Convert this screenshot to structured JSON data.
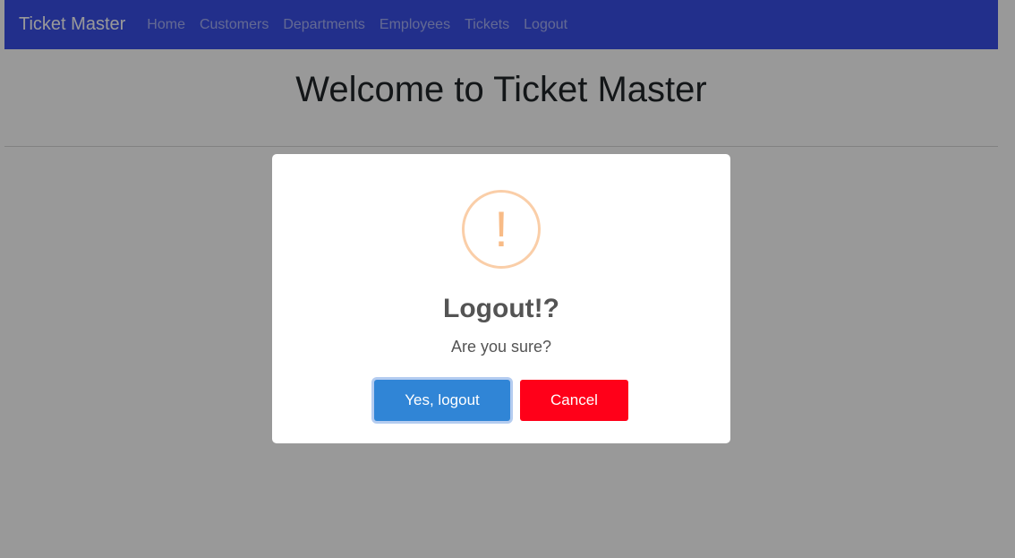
{
  "navbar": {
    "brand": "Ticket Master",
    "links": [
      "Home",
      "Customers",
      "Departments",
      "Employees",
      "Tickets",
      "Logout"
    ]
  },
  "main": {
    "heading": "Welcome to Ticket Master"
  },
  "dialog": {
    "icon": "warning-icon",
    "icon_glyph": "!",
    "title": "Logout!?",
    "text": "Are you sure?",
    "confirm_label": "Yes, logout",
    "cancel_label": "Cancel"
  },
  "colors": {
    "navbar": "#3a4fe8",
    "confirm": "#3085d6",
    "cancel": "#ff0019",
    "warning": "#f8bb86"
  }
}
